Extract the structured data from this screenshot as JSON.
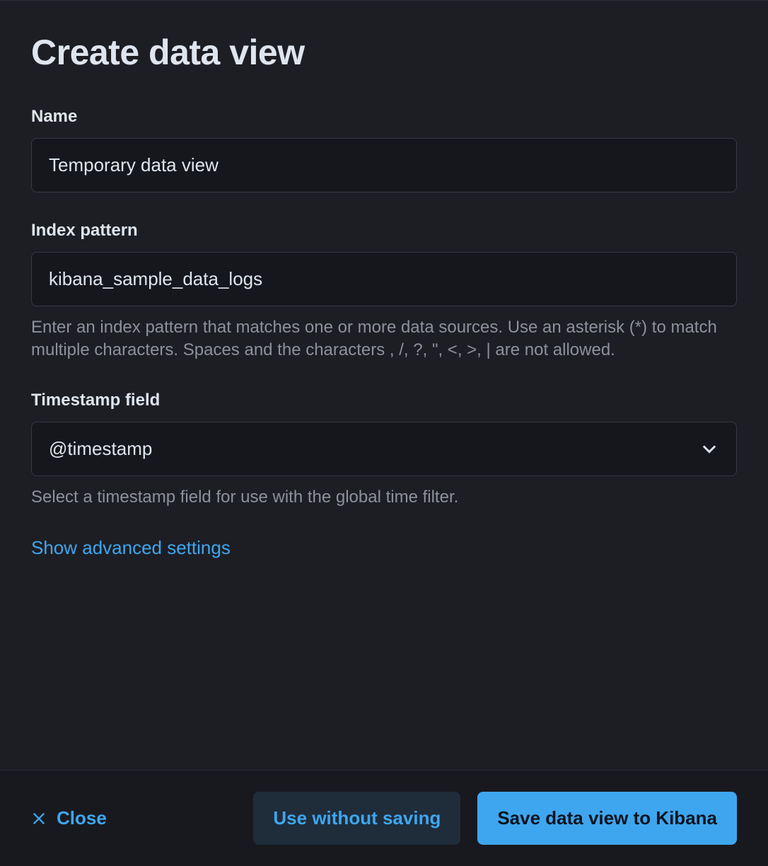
{
  "header": {
    "title": "Create data view"
  },
  "fields": {
    "name": {
      "label": "Name",
      "value": "Temporary data view"
    },
    "indexPattern": {
      "label": "Index pattern",
      "value": "kibana_sample_data_logs",
      "help": "Enter an index pattern that matches one or more data sources. Use an asterisk (*) to match multiple characters. Spaces and the characters , /, ?, \", <, >, | are not allowed."
    },
    "timestampField": {
      "label": "Timestamp field",
      "value": "@timestamp",
      "help": "Select a timestamp field for use with the global time filter."
    }
  },
  "links": {
    "advancedSettings": "Show advanced settings"
  },
  "footer": {
    "close": "Close",
    "useWithoutSaving": "Use without saving",
    "save": "Save data view to Kibana"
  }
}
